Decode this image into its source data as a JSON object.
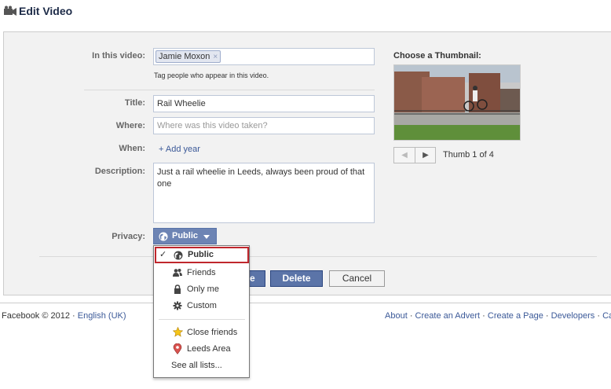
{
  "header": {
    "title": "Edit Video",
    "icon": "video-camera-icon"
  },
  "form": {
    "in_this_video": {
      "label": "In this video:",
      "tag": "Jamie Moxon",
      "remove_glyph": "×",
      "hint": "Tag people who appear in this video."
    },
    "title": {
      "label": "Title:",
      "value": "Rail Wheelie"
    },
    "where": {
      "label": "Where:",
      "placeholder": "Where was this video taken?"
    },
    "when": {
      "label": "When:",
      "add_year": "+ Add year"
    },
    "description": {
      "label": "Description:",
      "value": "Just a rail wheelie in Leeds, always been proud of that one"
    },
    "privacy": {
      "label": "Privacy:",
      "value": "Public",
      "icon": "globe-icon"
    }
  },
  "buttons": {
    "save_fragment": "e",
    "delete": "Delete",
    "cancel": "Cancel"
  },
  "thumbnail": {
    "label": "Choose a Thumbnail:",
    "prev_glyph": "◀",
    "next_glyph": "▶",
    "count": "Thumb 1 of 4"
  },
  "privacy_menu": {
    "check_glyph": "✓",
    "items": [
      {
        "label": "Public",
        "icon": "globe-icon",
        "selected": true
      },
      {
        "label": "Friends",
        "icon": "friends-icon"
      },
      {
        "label": "Only me",
        "icon": "lock-icon"
      },
      {
        "label": "Custom",
        "icon": "gear-icon"
      },
      {
        "label": "Close friends",
        "icon": "star-icon"
      },
      {
        "label": "Leeds Area",
        "icon": "location-pin-icon"
      },
      {
        "label": "See all lists..."
      }
    ]
  },
  "footer": {
    "copyright": "Facebook © 2012 ·",
    "language": "English (UK)",
    "links": [
      "About",
      "Create an Advert",
      "Create a Page",
      "Developers",
      "Ca"
    ],
    "separator": "·"
  },
  "colors": {
    "brand": "#3b5998",
    "button_blue": "#5b74a8",
    "privacy_blue": "#6d84b4",
    "highlight_red": "#c0272d"
  }
}
